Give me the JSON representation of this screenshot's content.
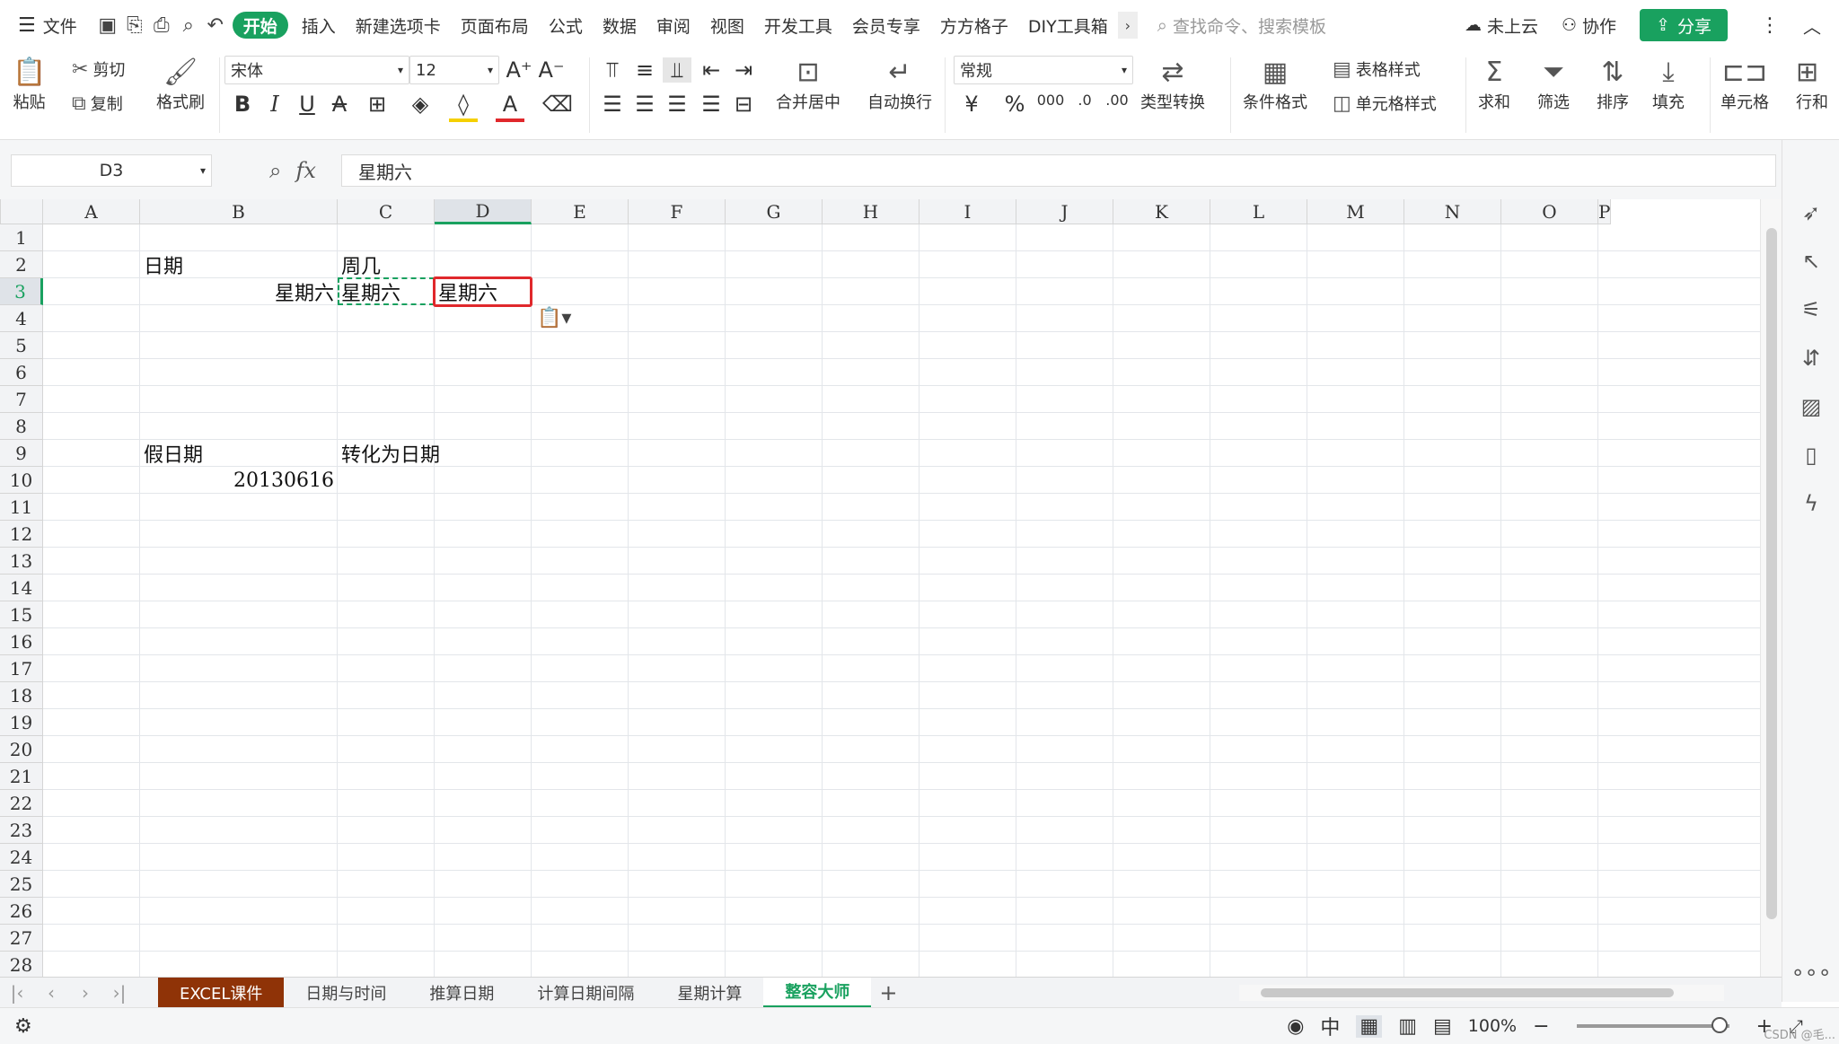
{
  "menu": {
    "file": "文件",
    "tabs": [
      "开始",
      "插入",
      "新建选项卡",
      "页面布局",
      "公式",
      "数据",
      "审阅",
      "视图",
      "开发工具",
      "会员专享",
      "方方格子",
      "DIY工具箱"
    ],
    "active_tab": "开始",
    "search_placeholder": "查找命令、搜索模板",
    "cloud": "未上云",
    "collab": "协作",
    "share": "分享"
  },
  "ribbon": {
    "paste": "粘贴",
    "cut": "剪切",
    "copy": "复制",
    "format_painter": "格式刷",
    "font_name": "宋体",
    "font_size": "12",
    "merge_center": "合并居中",
    "wrap_text": "自动换行",
    "number_format": "常规",
    "type_convert": "类型转换",
    "cond_format": "条件格式",
    "table_style": "表格样式",
    "cell_style": "单元格样式",
    "sum": "求和",
    "filter": "筛选",
    "sort": "排序",
    "fill": "填充",
    "cell": "单元格",
    "row_col": "行和"
  },
  "formula_bar": {
    "name_box": "D3",
    "fx": "fx",
    "content": "星期六"
  },
  "grid": {
    "columns": [
      "A",
      "B",
      "C",
      "D",
      "E",
      "F",
      "G",
      "H",
      "I",
      "J",
      "K",
      "L",
      "M",
      "N",
      "O",
      "P"
    ],
    "rows": [
      "1",
      "2",
      "3",
      "4",
      "5",
      "6",
      "7",
      "8",
      "9",
      "10",
      "11",
      "12",
      "13",
      "14",
      "15",
      "16",
      "17",
      "18",
      "19",
      "20",
      "21",
      "22",
      "23",
      "24",
      "25",
      "26",
      "27",
      "28"
    ],
    "selected_cell": "D3",
    "cells": {
      "B2": "日期",
      "C2": "周几",
      "B3": "星期六",
      "C3": "星期六",
      "D3": "星期六",
      "B9": "假日期",
      "C9": "转化为日期",
      "B10": "20130616"
    }
  },
  "sheets": {
    "tabs": [
      "EXCEL课件",
      "日期与时间",
      "推算日期",
      "计算日期间隔",
      "星期计算",
      "整容大师"
    ],
    "active": "整容大师"
  },
  "status": {
    "zoom": "100%",
    "watermark": "CSDN @毛..."
  },
  "colors": {
    "accent": "#19a15f",
    "selection_border": "#e0282c",
    "first_sheet_tab": "#8f3307"
  }
}
